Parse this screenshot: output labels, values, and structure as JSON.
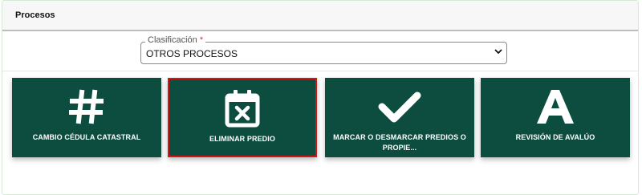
{
  "panel": {
    "title": "Procesos"
  },
  "classification": {
    "label": "Clasificación",
    "required_mark": "*",
    "value": "OTROS PROCESOS"
  },
  "cards": [
    {
      "label": "CAMBIO CÉDULA CATASTRAL",
      "icon": "hash-icon",
      "selected": false
    },
    {
      "label": "ELIMINAR PREDIO",
      "icon": "calendar-x-icon",
      "selected": true
    },
    {
      "label": "MARCAR O DESMARCAR PREDIOS O PROPIE...",
      "icon": "check-icon",
      "selected": false
    },
    {
      "label": "REVISIÓN DE AVALÚO",
      "icon": "letter-a-icon",
      "selected": false
    }
  ],
  "colors": {
    "card_bg": "#0c4d40",
    "selected_border": "#d01818",
    "required": "#dd3333"
  }
}
